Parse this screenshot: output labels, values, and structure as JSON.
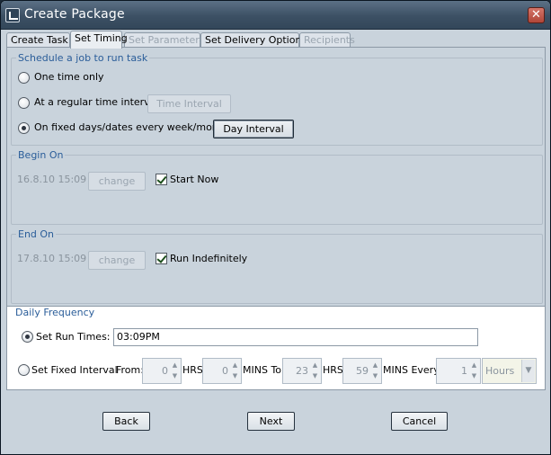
{
  "window": {
    "title": "Create Package",
    "close_glyph": "✕"
  },
  "tabs": [
    {
      "label": "Create Task",
      "state": "normal"
    },
    {
      "label": "Set Timing",
      "state": "active"
    },
    {
      "label": "Set Parameters",
      "state": "disabled"
    },
    {
      "label": "Set Delivery Options",
      "state": "normal"
    },
    {
      "label": "Recipients",
      "state": "disabled"
    }
  ],
  "schedule": {
    "legend": "Schedule a job to run task",
    "option_one_time": "One time only",
    "option_interval": "At a regular time interval",
    "time_interval_button": "Time Interval",
    "option_fixed_days": "On fixed days/dates every week/month",
    "day_interval_button": "Day Interval",
    "selected": "fixed_days"
  },
  "begin_on": {
    "legend": "Begin On",
    "date_value": "16.8.10 15:09",
    "change_label": "change",
    "start_now_label": "Start Now",
    "start_now_checked": true
  },
  "end_on": {
    "legend": "End On",
    "date_value": "17.8.10 15:09",
    "change_label": "change",
    "run_indefinitely_label": "Run Indefinitely",
    "run_indefinitely_checked": true
  },
  "daily_frequency": {
    "legend": "Daily Frequency",
    "set_run_times_label": "Set Run Times:",
    "run_times_value": "03:09PM",
    "set_fixed_interval_label": "Set Fixed Interval",
    "from_label": "From:",
    "from_hrs": "0",
    "hrs_label": "HRS",
    "from_mins": "0",
    "mins_to_label": "MINS To:",
    "to_hrs": "23",
    "hrs_label_2": "HRS",
    "to_mins": "59",
    "mins_every_label": "MINS Every",
    "every_value": "1",
    "unit_value": "Hours",
    "selected": "run_times"
  },
  "footer": {
    "back_label": "Back",
    "next_label": "Next",
    "cancel_label": "Cancel"
  },
  "icons": {
    "spinner_up": "▲",
    "spinner_down": "▼",
    "dropdown": "▼"
  }
}
